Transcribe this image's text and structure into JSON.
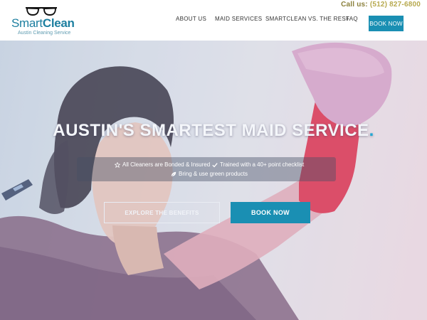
{
  "header": {
    "call_label": "Call us:",
    "phone": "(512) 827-6800",
    "logo": {
      "brand_light": "Smart",
      "brand_bold": "Clean",
      "tagline": "Austin Cleaning Service"
    },
    "nav": {
      "about": "ABOUT US",
      "maid_services": "MAID SERVICES",
      "vs": "SMARTCLEAN VS. THE REST",
      "faq": "FAQ",
      "book": "BOOK NOW"
    },
    "accent_color": "#1a8fb3"
  },
  "hero": {
    "headline": "AUSTIN'S SMARTEST MAID SERVICE",
    "headline_dot": ".",
    "checks": [
      {
        "icon": "star-icon",
        "text": "All Cleaners are Bonded & Insured"
      },
      {
        "icon": "checkmark-icon",
        "text": "Trained with a 40+ point checklist"
      },
      {
        "icon": "leaf-icon",
        "text": "Bring & use green products"
      }
    ],
    "explore_button": "EXPLORE THE BENEFITS",
    "book_button": "BOOK NOW",
    "image_subject": "woman-with-red-glove-and-pink-cloth"
  }
}
